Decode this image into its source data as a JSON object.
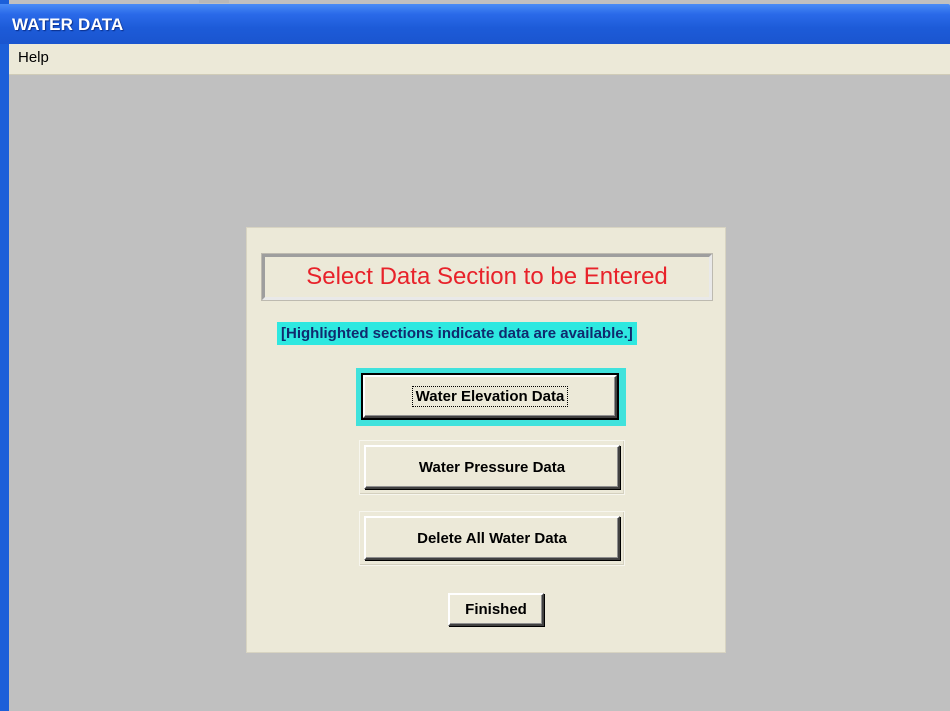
{
  "window": {
    "title": "WATER DATA",
    "frame_color": "#1c5fd9",
    "background_color": "#c0c0c0"
  },
  "menubar": {
    "items": [
      {
        "label": "Help"
      }
    ]
  },
  "panel": {
    "heading": "Select Data Section to be Entered",
    "heading_color": "#e8222a",
    "note": "[Highlighted sections indicate data are available.]",
    "note_background": "#2ee8e0",
    "buttons": [
      {
        "label": "Water Elevation Data",
        "highlighted": true,
        "focused": true
      },
      {
        "label": "Water Pressure Data",
        "highlighted": false,
        "focused": false
      },
      {
        "label": "Delete All Water Data",
        "highlighted": false,
        "focused": false
      }
    ],
    "finished_label": "Finished"
  }
}
